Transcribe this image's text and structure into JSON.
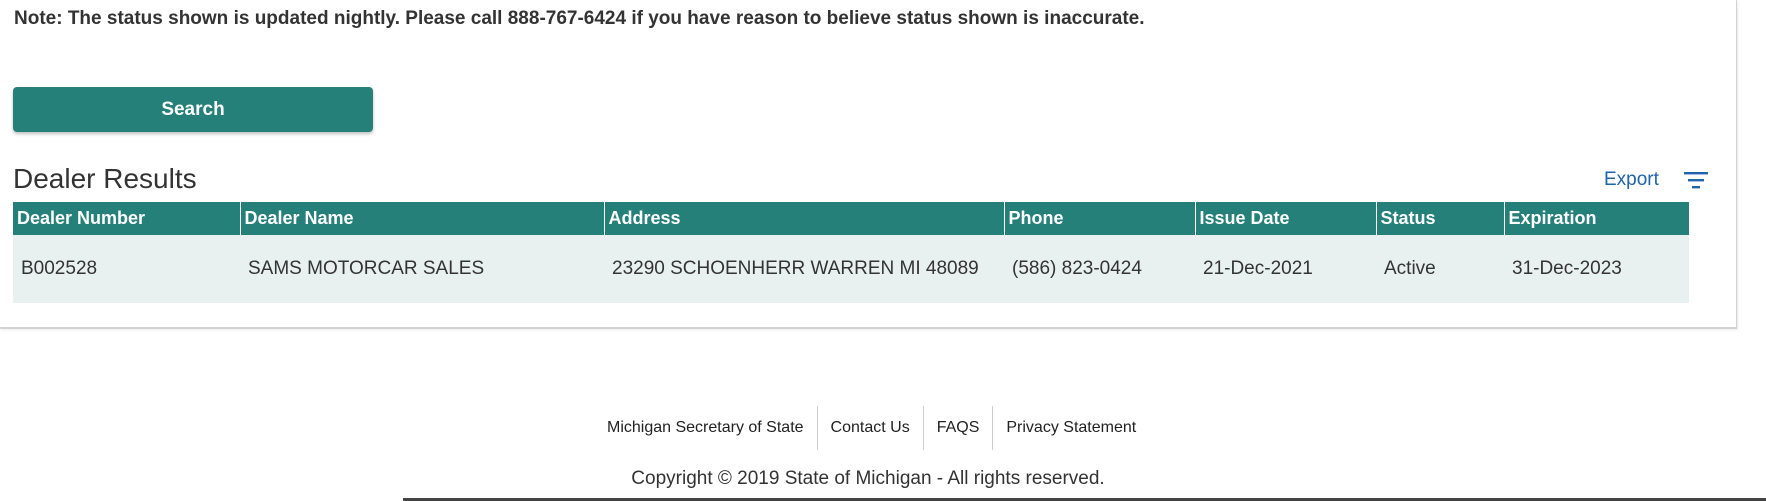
{
  "note": "Note: The status shown is updated nightly. Please call 888-767-6424 if you have reason to believe status shown is inaccurate.",
  "search_button": "Search",
  "results": {
    "title": "Dealer Results",
    "export_label": "Export",
    "filter_icon": "filter-icon",
    "columns": [
      "Dealer Number",
      "Dealer Name",
      "Address",
      "Phone",
      "Issue Date",
      "Status",
      "Expiration"
    ],
    "rows": [
      [
        "B002528",
        "SAMS MOTORCAR SALES",
        "23290 SCHOENHERR WARREN MI 48089",
        "(586) 823-0424",
        "21-Dec-2021",
        "Active",
        "31-Dec-2023"
      ]
    ]
  },
  "footer": {
    "links": [
      "Michigan Secretary of State",
      "Contact Us",
      "FAQS",
      "Privacy Statement"
    ],
    "copyright": "Copyright © 2019 State of Michigan - All rights reserved."
  },
  "colors": {
    "primary": "#26807a",
    "link": "#1f63a8",
    "row_bg": "#e8f0f0"
  }
}
